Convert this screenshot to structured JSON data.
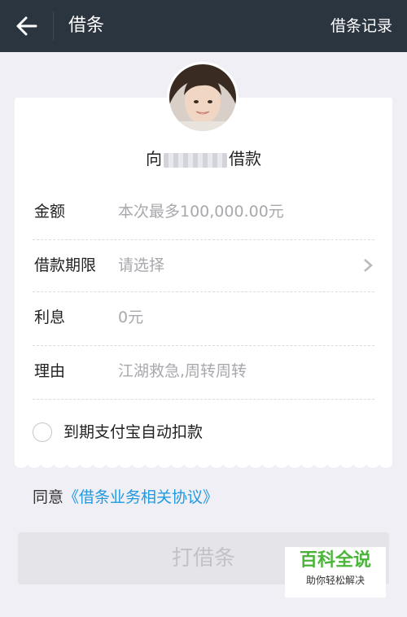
{
  "nav": {
    "title": "借条",
    "records_label": "借条记录"
  },
  "borrow": {
    "prefix": "向",
    "suffix": "借款"
  },
  "rows": [
    {
      "label": "金额",
      "value": "本次最多100,000.00元"
    },
    {
      "label": "借款期限",
      "value": "请选择"
    },
    {
      "label": "利息",
      "value": "0元"
    },
    {
      "label": "理由",
      "value": "江湖救急,周转周转"
    }
  ],
  "auto_pay": {
    "label": "到期支付宝自动扣款"
  },
  "agree": {
    "prefix": "同意",
    "link": "《借条业务相关协议》"
  },
  "submit": {
    "label": "打借条"
  },
  "watermark": {
    "title": "百科全说",
    "subtitle": "助你轻松解决"
  },
  "icons": {
    "back": "back-arrow-icon",
    "chevron": "chevron-right-icon",
    "radio": "radio-unchecked-icon"
  },
  "colors": {
    "nav_bg": "#2b3540",
    "link": "#1f99e0",
    "page_bg": "#f0eff5",
    "watermark_green": "#4bb53a"
  }
}
